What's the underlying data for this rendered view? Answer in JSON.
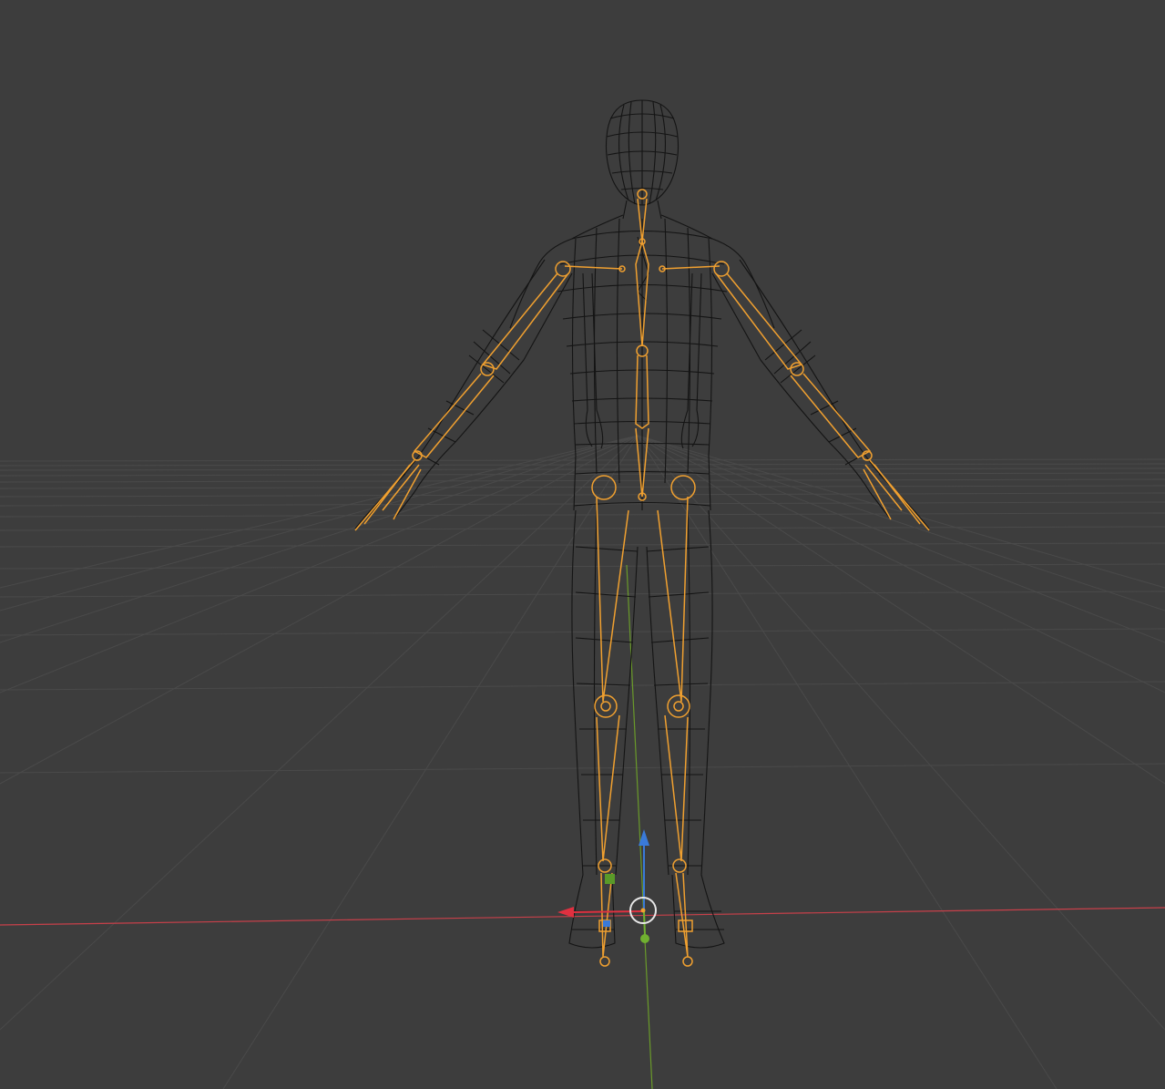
{
  "viewport": {
    "background_color": "#3d3d3d",
    "grid_color": "#4a4a4a",
    "wireframe_color": "#141414",
    "armature_color": "#f0a030",
    "axis_x_color": "#c8404a",
    "axis_y_color": "#6a9a2a",
    "gizmo_x_color": "#e03040",
    "gizmo_y_color": "#70b030",
    "gizmo_z_color": "#3a7ad8",
    "cursor_color": "#e8e8e8"
  },
  "icons": {
    "object_origin": "origin-dot-icon",
    "cursor": "3d-cursor-icon"
  }
}
